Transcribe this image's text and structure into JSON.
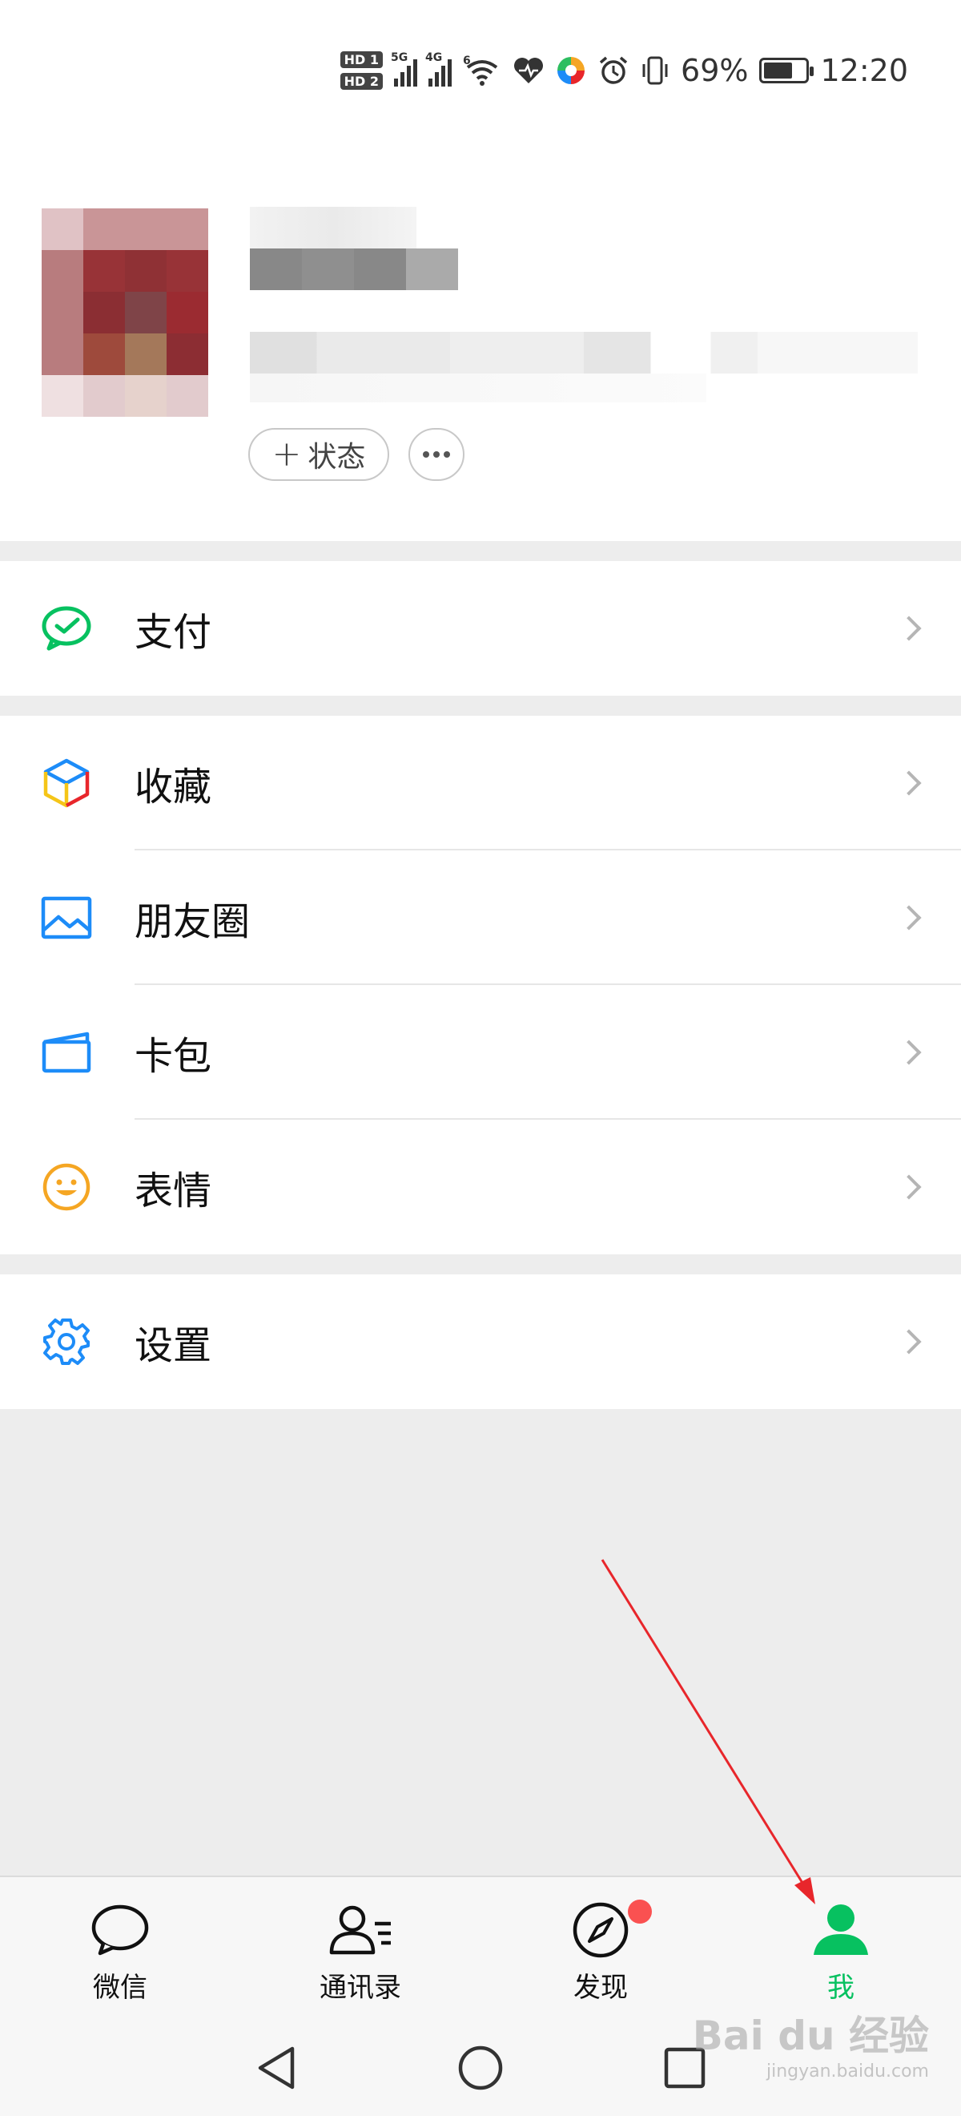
{
  "status_bar": {
    "hd1": "HD 1",
    "hd2": "HD 2",
    "net1": "5G",
    "net2": "4G",
    "wifi_tag": "6",
    "battery_percent": "69%",
    "battery_level": 0.69,
    "time": "12:20"
  },
  "profile": {
    "status_button": "状态",
    "more_icon": "ellipsis-icon"
  },
  "menu": {
    "pay": "支付",
    "favorites": "收藏",
    "moments": "朋友圈",
    "cards": "卡包",
    "stickers": "表情",
    "settings": "设置"
  },
  "tabs": {
    "chats": "微信",
    "contacts": "通讯录",
    "discover": "发现",
    "me": "我"
  },
  "colors": {
    "accent_green": "#07c160",
    "badge_red": "#fa5151",
    "arrow_red": "#e8262b"
  },
  "watermark": {
    "brand": "Bai du 经验",
    "url": "jingyan.baidu.com"
  }
}
